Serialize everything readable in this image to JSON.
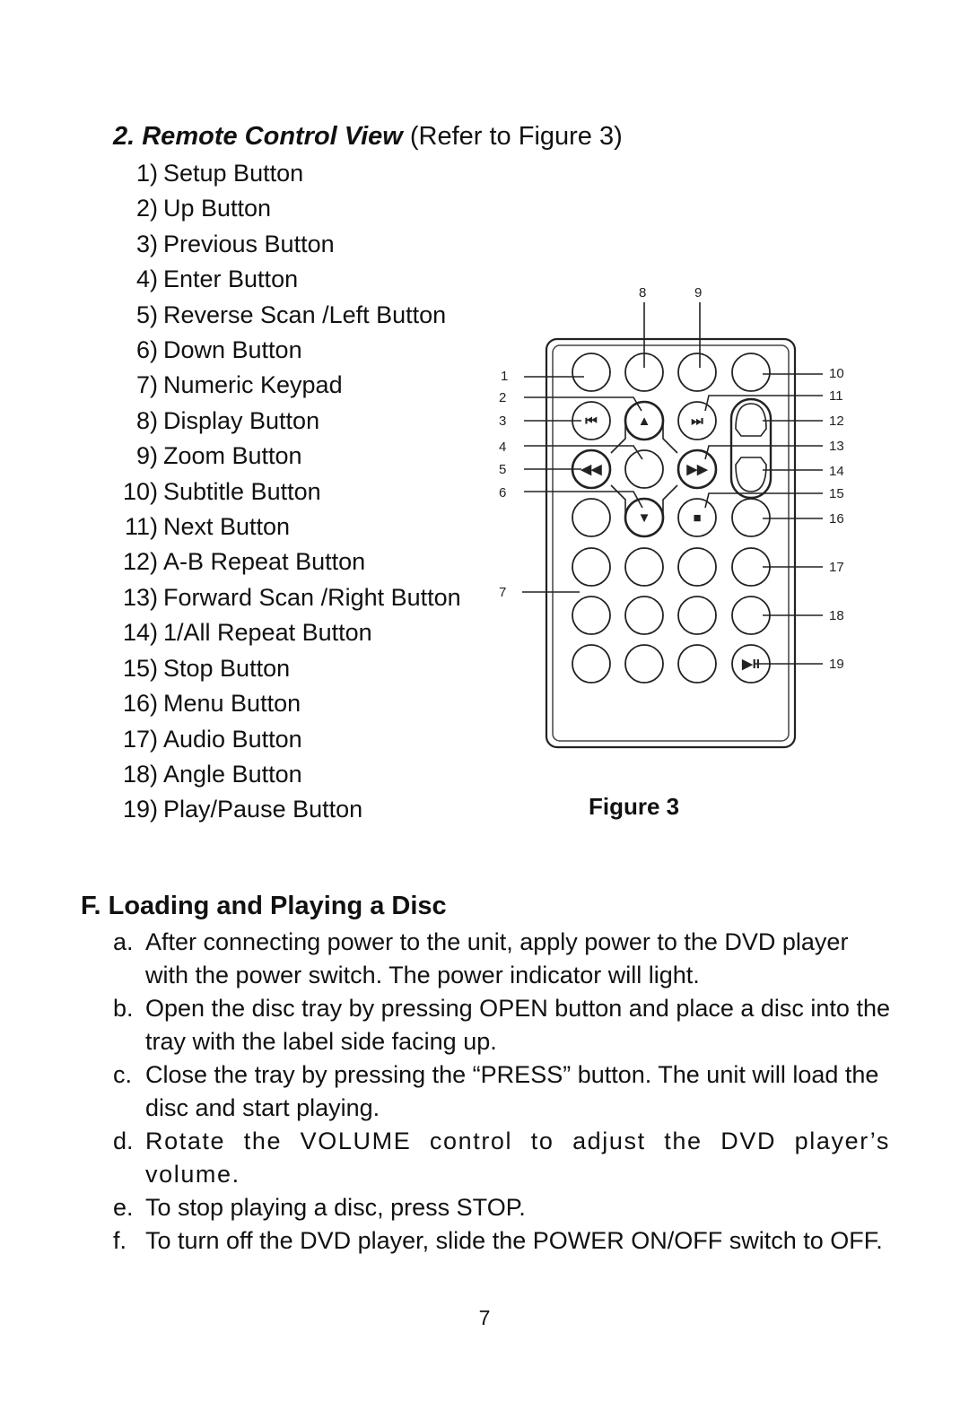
{
  "section2": {
    "title_bold": "2. Remote Control View",
    "title_rest": " (Refer to Figure 3)",
    "items": [
      {
        "num": "1)",
        "label": "Setup Button"
      },
      {
        "num": "2)",
        "label": "Up Button"
      },
      {
        "num": "3)",
        "label": "Previous Button"
      },
      {
        "num": "4)",
        "label": "Enter Button"
      },
      {
        "num": "5)",
        "label": "Reverse Scan /Left Button"
      },
      {
        "num": "6)",
        "label": "Down Button"
      },
      {
        "num": "7)",
        "label": "Numeric Keypad"
      },
      {
        "num": "8)",
        "label": "Display Button"
      },
      {
        "num": "9)",
        "label": "Zoom Button"
      },
      {
        "num": "10)",
        "label": "Subtitle Button"
      },
      {
        "num": "11)",
        "label": "Next Button"
      },
      {
        "num": "12)",
        "label": "A-B Repeat Button"
      },
      {
        "num": "13)",
        "label": "Forward Scan /Right Button"
      },
      {
        "num": "14)",
        "label": "1/All Repeat Button"
      },
      {
        "num": "15)",
        "label": "Stop Button"
      },
      {
        "num": "16)",
        "label": "Menu Button"
      },
      {
        "num": "17)",
        "label": "Audio Button"
      },
      {
        "num": "18)",
        "label": "Angle Button"
      },
      {
        "num": "19)",
        "label": "Play/Pause Button"
      }
    ]
  },
  "figure": {
    "caption": "Figure 3",
    "callouts": [
      "1",
      "2",
      "3",
      "4",
      "5",
      "6",
      "7",
      "8",
      "9",
      "10",
      "11",
      "12",
      "13",
      "14",
      "15",
      "16",
      "17",
      "18",
      "19"
    ],
    "icons": {
      "previous": "⏮",
      "up": "▲",
      "next": "⏭",
      "reverse": "◀◀",
      "forward": "▶▶",
      "down": "▼",
      "stop": "■",
      "play_pause": "▶II"
    }
  },
  "sectionF": {
    "title": "F. Loading and Playing a Disc",
    "items": [
      {
        "label": "a.",
        "text": "After connecting power to the unit, apply power to the DVD player with the power switch. The power indicator will light."
      },
      {
        "label": "b.",
        "text": "Open the disc tray by pressing OPEN button and place a disc into the tray with the label side facing up."
      },
      {
        "label": "c.",
        "text": "Close the tray by pressing the “PRESS” button. The unit will load the disc and start playing."
      },
      {
        "label": "d.",
        "text": "Rotate the VOLUME control to adjust the DVD player’s volume."
      },
      {
        "label": "e.",
        "text": "To stop playing a disc, press STOP."
      },
      {
        "label": "f.",
        "text": "To turn off the DVD player, slide the POWER ON/OFF switch to OFF."
      }
    ]
  },
  "page_number": "7"
}
